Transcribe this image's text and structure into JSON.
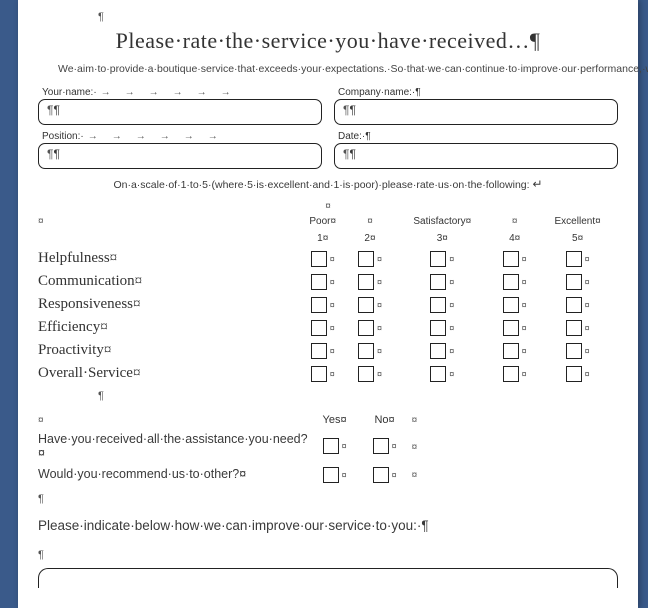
{
  "title": "Please·rate·the·service·you·have·received…¶",
  "intro": "We·aim·to·provide·a·boutique·service·that·exceeds·your·expectations.·So·that·we·can·continue·to·improve·our·performance,·would·you·please·complete·and·return·the·following¤",
  "fields": {
    "name_label": "Your·name:·",
    "company_label": "Company·name:·¶",
    "position_label": "Position:·",
    "date_label": "Date:·¶",
    "value": "¶"
  },
  "scale_instruction": "On·a·scale·of·1·to·5·(where·5·is·excellent·and·1·is·poor)·please·rate·us·on·the·following:",
  "rating_headers": {
    "poor": "Poor¤",
    "sat": "Satisfactory¤",
    "exc": "Excellent¤",
    "n1": "1¤",
    "n2": "2¤",
    "n3": "3¤",
    "n4": "4¤",
    "n5": "5¤"
  },
  "rating_rows": [
    "Helpfulness¤",
    "Communication¤",
    "Responsiveness¤",
    "Efficiency¤",
    "Proactivity¤",
    "Overall·Service¤"
  ],
  "yn_headers": {
    "yes": "Yes¤",
    "no": "No¤"
  },
  "yn_rows": [
    "Have·you·received·all·the·assistance·you·need?¤",
    "Would·you·recommend·us·to·other?¤"
  ],
  "improve_prompt": "Please·indicate·below·how·we·can·improve·our·service·to·you:·¶",
  "cell_mark": "¤",
  "tab_arrow": "→"
}
